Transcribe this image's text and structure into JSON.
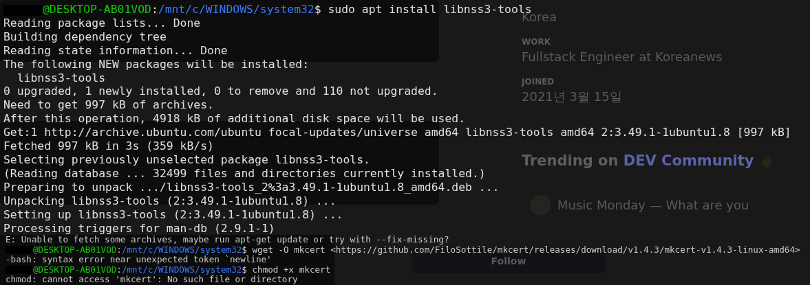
{
  "profile": {
    "location": "Korea",
    "fields": [
      {
        "label": "WORK",
        "value": "Fullstack Engineer at Koreanews"
      },
      {
        "label": "JOINED",
        "value": "2021년 3월 15일"
      }
    ]
  },
  "trending": {
    "title": "Trending on",
    "highlight": "DEV Community",
    "items": [
      {
        "title": "Music Monday — What are you"
      }
    ]
  },
  "follow_button": "Follow",
  "terminal": {
    "prompt": {
      "host": "@DESKTOP-AB01VOD",
      "sep": ":",
      "path": "/mnt/c/WINDOWS/system32",
      "command": "$ sudo apt install libnss3-tools"
    },
    "lines": [
      "Reading package lists... Done",
      "Building dependency tree",
      "Reading state information... Done",
      "The following NEW packages will be installed:",
      "  libnss3-tools",
      "0 upgraded, 1 newly installed, 0 to remove and 110 not upgraded.",
      "Need to get 997 kB of archives.",
      "After this operation, 4918 kB of additional disk space will be used.",
      "Get:1 http://archive.ubuntu.com/ubuntu focal-updates/universe amd64 libnss3-tools amd64 2:3.49.1-1ubuntu1.8 [997 kB]",
      "Fetched 997 kB in 3s (359 kB/s)",
      "Selecting previously unselected package libnss3-tools.",
      "(Reading database ... 32499 files and directories currently installed.)",
      "Preparing to unpack .../libnss3-tools_2%3a3.49.1-1ubuntu1.8_amd64.deb ...",
      "Unpacking libnss3-tools (2:3.49.1-1ubuntu1.8) ...",
      "Setting up libnss3-tools (2:3.49.1-1ubuntu1.8) ...",
      "Processing triggers for man-db (2.9.1-1)"
    ]
  },
  "shell": {
    "lines": [
      {
        "kind": "output",
        "text": "E: Unable to fetch some archives, maybe run apt-get update or try with --fix-missing?"
      },
      {
        "kind": "prompt",
        "host": "@DESKTOP-AB01VOD",
        "sep": ":",
        "path": "/mnt/c/WINDOWS/system32",
        "command": "$ wget -O mkcert <https://github.com/FiloSottile/mkcert/releases/download/v1.4.3/mkcert-v1.4.3-linux-amd64>"
      },
      {
        "kind": "output",
        "text": "-bash: syntax error near unexpected token `newline'"
      },
      {
        "kind": "prompt",
        "host": "@DESKTOP-AB01VOD",
        "sep": ":",
        "path": "/mnt/c/WINDOWS/system32",
        "command": "$ chmod +x mkcert"
      },
      {
        "kind": "output",
        "text": "chmod: cannot access 'mkcert': No such file or directory"
      }
    ]
  }
}
